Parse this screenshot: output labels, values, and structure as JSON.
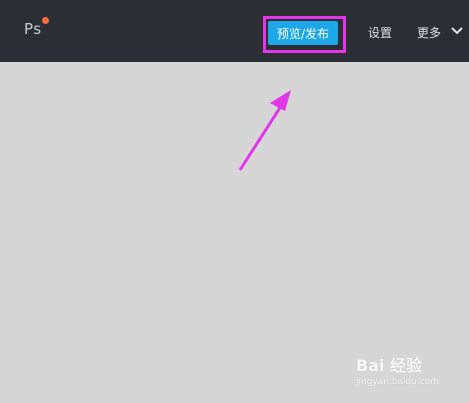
{
  "header": {
    "logo_text": "Ps",
    "publish_label": "预览/发布",
    "settings_label": "设置",
    "more_label": "更多"
  },
  "icons": {
    "logo": "photoshop-logo-icon",
    "chevron": "chevron-down-icon",
    "annotation": "arrow-icon"
  },
  "colors": {
    "topbar": "#2b2f33",
    "canvas": "#d6d6d6",
    "publish_button": "#1da7e8",
    "annotation": "#e236e8",
    "logo_dot": "#ff6b3d"
  },
  "watermark": {
    "main": "Bai  经验",
    "sub": "jingyan.baidu.com"
  }
}
